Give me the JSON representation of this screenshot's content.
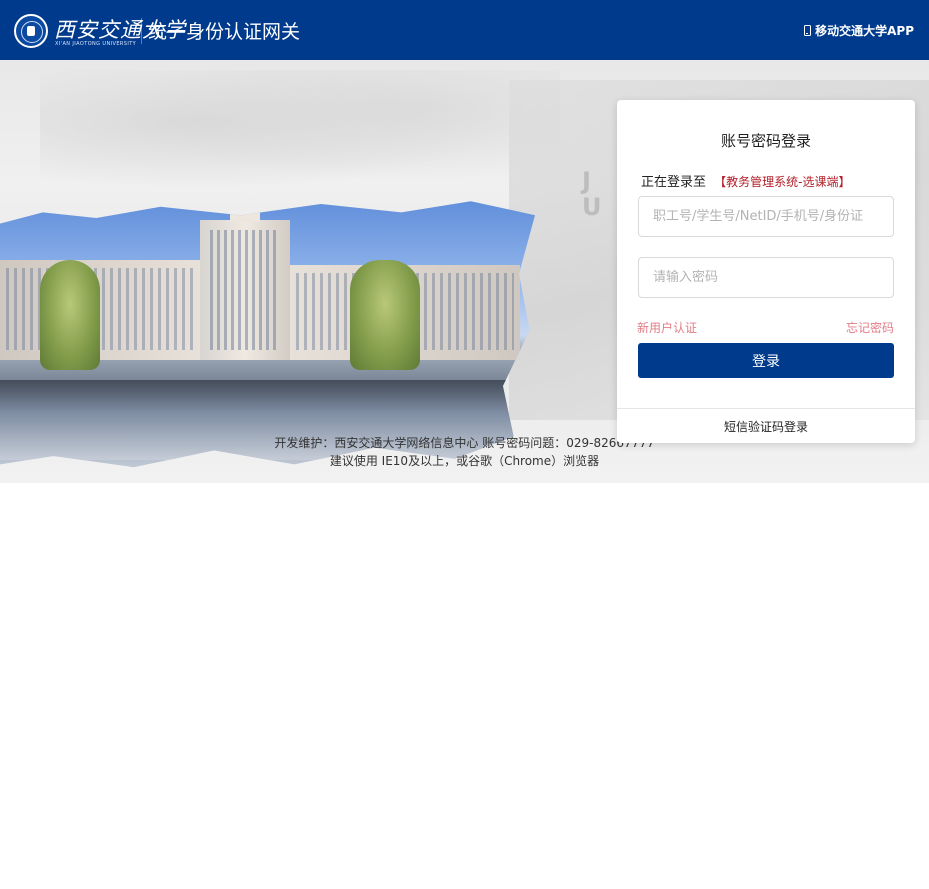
{
  "header": {
    "logo_text": "西安交通大学",
    "logo_subtext": "XI'AN JIAOTONG UNIVERSITY",
    "title": "统一身份认证网关",
    "app_link_label": "移动交通大学APP",
    "app_link_icon": "phone-icon",
    "background_color": "#003a8c"
  },
  "login": {
    "title": "账号密码登录",
    "logging_prefix": "正在登录至",
    "logging_target": "【教务管理系统-选课端】",
    "username_placeholder": "职工号/学生号/NetID/手机号/身份证",
    "password_placeholder": "请输入密码",
    "new_user_link": "新用户认证",
    "forgot_password_link": "忘记密码",
    "login_button": "登录",
    "sms_login_link": "短信验证码登录",
    "accent_color": "#003a8c",
    "link_color": "#e07d87",
    "target_color": "#b3202a"
  },
  "hero": {
    "background_letters": "J\nU"
  },
  "footer": {
    "line1": "开发维护：西安交通大学网络信息中心    账号密码问题：029-82667777",
    "line2": "建议使用 IE10及以上，或谷歌（Chrome）浏览器"
  }
}
